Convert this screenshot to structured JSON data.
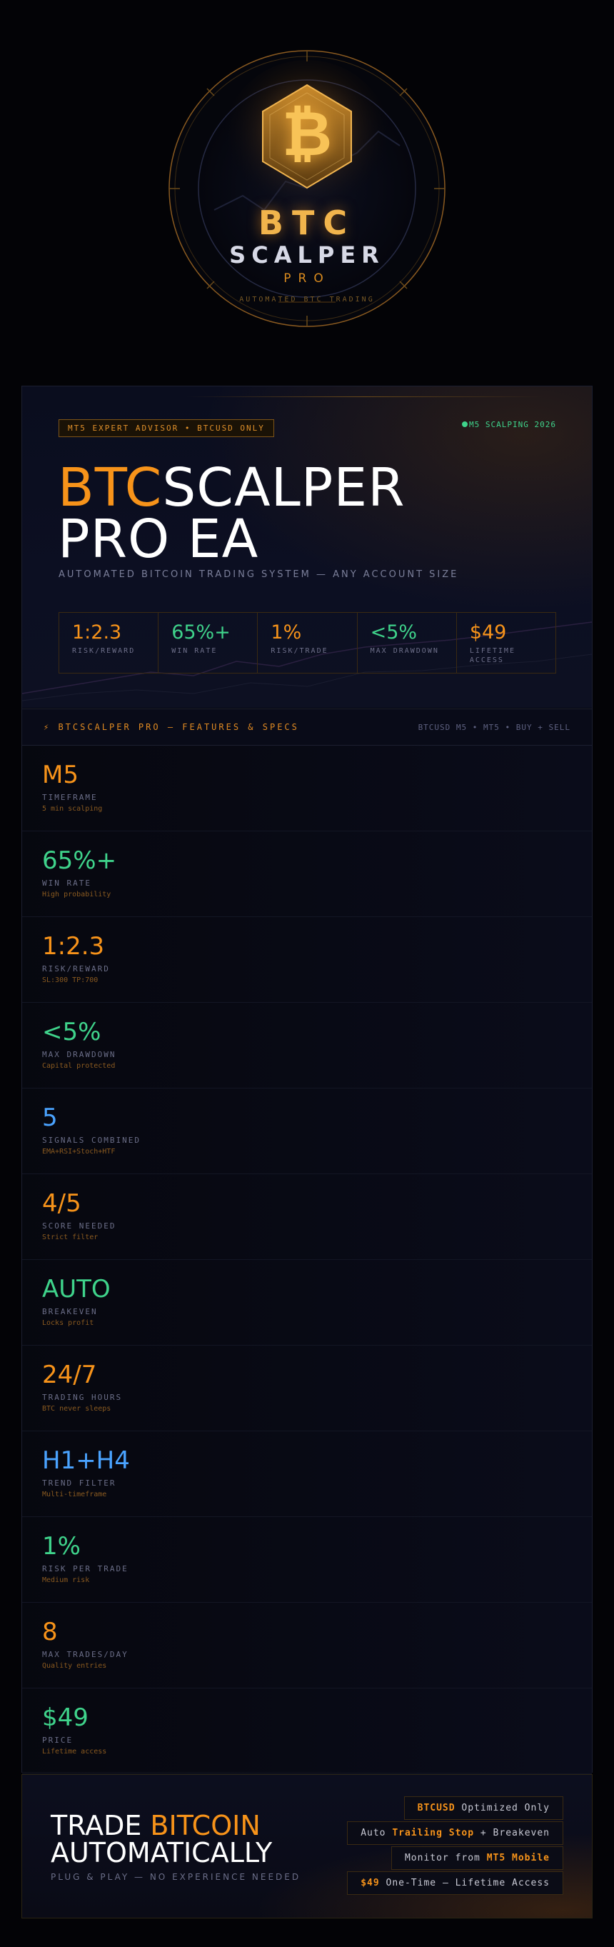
{
  "logo": {
    "btc": "BTC",
    "scalper": "SCALPER",
    "pro": "PRO",
    "tagline": "AUTOMATED BTC TRADING",
    "coin_symbol": "₿",
    "colors": {
      "gold": "#f7931a",
      "ring": "#8a5a20"
    }
  },
  "hero": {
    "tag": "MT5 EXPERT ADVISOR • BTCUSD ONLY",
    "live": "M5 SCALPING 2026",
    "title_orange": "BTC",
    "title_white": "SCALPER",
    "title_line2": "PRO EA",
    "subtitle": "AUTOMATED BITCOIN TRADING SYSTEM — ANY ACCOUNT SIZE",
    "stats": [
      {
        "value": "1:2.3",
        "label": "RISK/REWARD",
        "color": "orange"
      },
      {
        "value": "65%+",
        "label": "WIN RATE",
        "color": "green"
      },
      {
        "value": "1%",
        "label": "RISK/TRADE",
        "color": "orange"
      },
      {
        "value": "<5%",
        "label": "MAX DRAWDOWN",
        "color": "green"
      },
      {
        "value": "$49",
        "label": "LIFETIME ACCESS",
        "color": "orange"
      }
    ]
  },
  "features": {
    "title": "⚡ BTCSCALPER PRO — FEATURES & SPECS",
    "right": "BTCUSD M5 • MT5 • BUY + SELL",
    "rows": [
      {
        "value": "M5",
        "label": "TIMEFRAME",
        "desc": "5 min scalping",
        "color": "orange"
      },
      {
        "value": "65%+",
        "label": "WIN RATE",
        "desc": "High probability",
        "color": "green"
      },
      {
        "value": "1:2.3",
        "label": "RISK/REWARD",
        "desc": "SL:300 TP:700",
        "color": "orange"
      },
      {
        "value": "<5%",
        "label": "MAX DRAWDOWN",
        "desc": "Capital protected",
        "color": "green"
      },
      {
        "value": "5",
        "label": "SIGNALS COMBINED",
        "desc": "EMA+RSI+Stoch+HTF",
        "color": "blue"
      },
      {
        "value": "4/5",
        "label": "SCORE NEEDED",
        "desc": "Strict filter",
        "color": "orange"
      },
      {
        "value": "AUTO",
        "label": "BREAKEVEN",
        "desc": "Locks profit",
        "color": "green"
      },
      {
        "value": "24/7",
        "label": "TRADING HOURS",
        "desc": "BTC never sleeps",
        "color": "orange"
      },
      {
        "value": "H1+H4",
        "label": "TREND FILTER",
        "desc": "Multi-timeframe",
        "color": "blue"
      },
      {
        "value": "1%",
        "label": "RISK PER TRADE",
        "desc": "Medium risk",
        "color": "green"
      },
      {
        "value": "8",
        "label": "MAX TRADES/DAY",
        "desc": "Quality entries",
        "color": "orange"
      },
      {
        "value": "$49",
        "label": "PRICE",
        "desc": "Lifetime access",
        "color": "green"
      }
    ]
  },
  "cta": {
    "line1_white": "TRADE ",
    "line1_orange": "BITCOIN",
    "line2": "AUTOMATICALLY",
    "sub": "PLUG & PLAY — NO EXPERIENCE NEEDED",
    "pills": [
      {
        "pre": "",
        "bold": "BTCUSD",
        "post": " Optimized Only"
      },
      {
        "pre": "Auto ",
        "bold": "Trailing Stop",
        "post": " + Breakeven"
      },
      {
        "pre": "Monitor from ",
        "bold": "MT5 Mobile",
        "post": ""
      },
      {
        "pre": "",
        "bold": "$49",
        "post": " One-Time — Lifetime Access"
      }
    ]
  }
}
